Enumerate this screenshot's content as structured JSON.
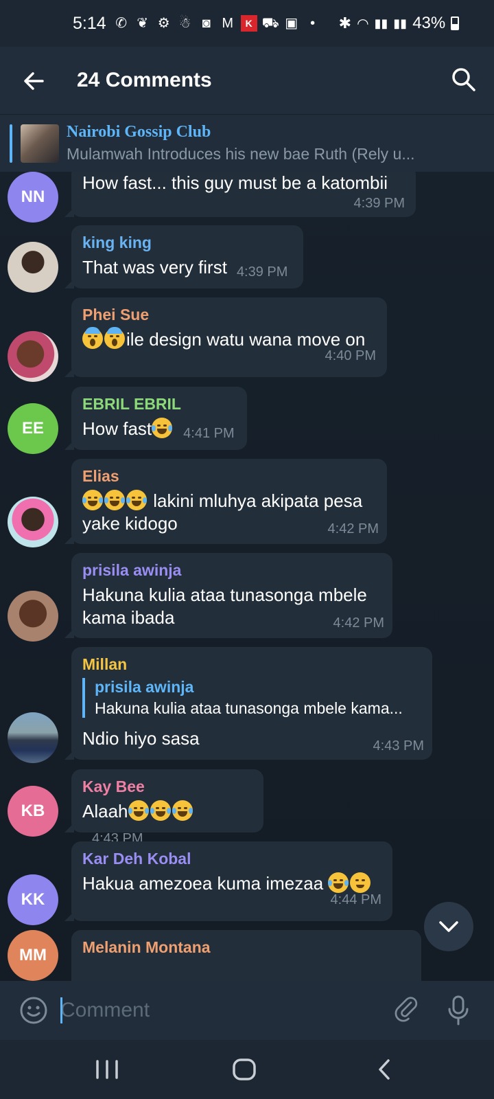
{
  "status_bar": {
    "time": "5:14",
    "battery": "43%",
    "icons": [
      "whatsapp-icon",
      "twitter-icon",
      "settings-badge-icon",
      "snapchat-icon",
      "instagram-icon",
      "gmail-icon",
      "kilimall-icon",
      "shopping-cart-icon",
      "gallery-icon",
      "dot-icon",
      "bluetooth-icon",
      "wifi-icon",
      "signal-icon",
      "signal-icon"
    ]
  },
  "header": {
    "title": "24 Comments"
  },
  "pinned": {
    "title": "Nairobi Gossip Club",
    "subtitle": "Mulamwah Introduces his new bae Ruth (Rely u..."
  },
  "messages": [
    {
      "avatar_initials": "NN",
      "avatar_color": "#8e85ee",
      "sender": "",
      "text": "How fast... this guy must be a katombii",
      "time": "4:39 PM"
    },
    {
      "avatar_initials": "",
      "sender": "king king",
      "sender_color": "#6ab3f3",
      "text": "That was very first",
      "time": "4:39 PM"
    },
    {
      "avatar_initials": "",
      "sender": "Phei Sue",
      "sender_color": "#f0a070",
      "text": "ile design watu wana move on",
      "time": "4:40 PM"
    },
    {
      "avatar_initials": "EE",
      "avatar_color": "#6cc84c",
      "sender": "EBRIL EBRIL",
      "sender_color": "#8cd97a",
      "text": "How fast",
      "time": "4:41 PM"
    },
    {
      "avatar_initials": "",
      "sender": "Elias",
      "sender_color": "#f0a070",
      "text": " lakini mluhya akipata pesa yake kidogo",
      "time": "4:42 PM"
    },
    {
      "avatar_initials": "",
      "sender": "prisila awinja",
      "sender_color": "#9a8ef2",
      "text": "Hakuna kulia ataa tunasonga mbele kama ibada",
      "time": "4:42 PM"
    },
    {
      "avatar_initials": "",
      "sender": "Millan",
      "sender_color": "#f5c542",
      "reply_name": "prisila awinja",
      "reply_text": "Hakuna kulia ataa tunasonga mbele kama...",
      "text": "Ndio hiyo sasa",
      "time": "4:43 PM"
    },
    {
      "avatar_initials": "KB",
      "avatar_color": "#e56d95",
      "sender": "Kay Bee",
      "sender_color": "#ef7fa3",
      "text": "Alaah",
      "time": "4:43 PM"
    },
    {
      "avatar_initials": "KK",
      "avatar_color": "#8e85ee",
      "sender": "Kar Deh Kobal",
      "sender_color": "#9a8ef2",
      "text": "Hakua amezoea kuma imezaa ",
      "time": "4:44 PM"
    },
    {
      "avatar_initials": "MM",
      "avatar_color": "#e0845c",
      "sender": "Melanin Montana",
      "sender_color": "#f0a070",
      "text": "",
      "time": ""
    }
  ],
  "composer": {
    "placeholder": "Comment"
  }
}
